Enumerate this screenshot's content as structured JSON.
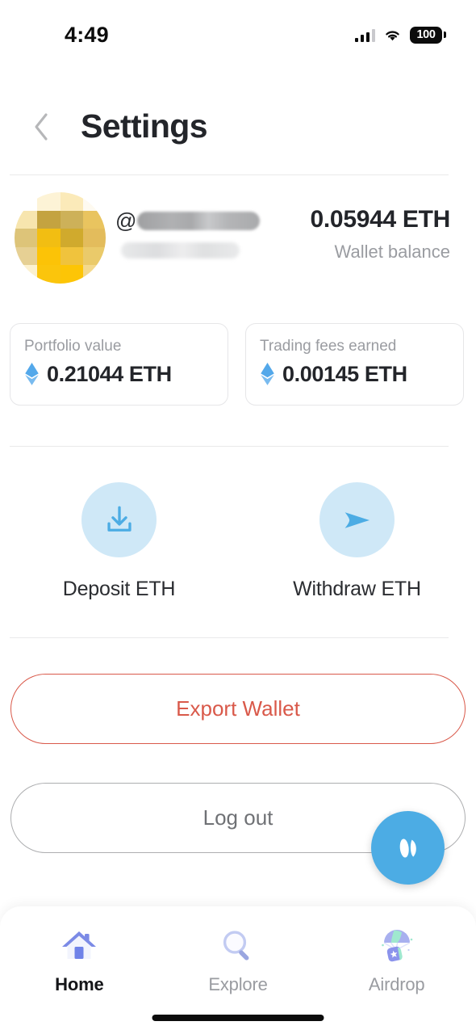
{
  "status_bar": {
    "time": "4:49",
    "battery_percent": "100",
    "icons": [
      "cellular-signal-icon",
      "wifi-icon",
      "battery-icon"
    ]
  },
  "header": {
    "back_icon": "chevron-left-icon",
    "title": "Settings"
  },
  "profile": {
    "avatar_icon": "pixelated-avatar",
    "avatar_colors": [
      "#ffffff",
      "#fdf2d2",
      "#fbe9b6",
      "#fdf6e2",
      "#f6e3ab",
      "#c3a13f",
      "#cdb059",
      "#e8c25d",
      "#ddc377",
      "#f2bd10",
      "#cfa92c",
      "#e2bb5a",
      "#e5cf92",
      "#fcc206",
      "#efc23c",
      "#e9c968",
      "#fbf0cd",
      "#fbc40b",
      "#fdc405",
      "#f3d municipality"
    ],
    "handle_prefix": "@",
    "handle_redacted": true,
    "subtitle_redacted": true,
    "balance_amount": "0.05944 ETH",
    "balance_label": "Wallet balance"
  },
  "stats": [
    {
      "label": "Portfolio value",
      "value": "0.21044 ETH",
      "icon": "ethereum-icon"
    },
    {
      "label": "Trading fees earned",
      "value": "0.00145 ETH",
      "icon": "ethereum-icon"
    }
  ],
  "actions": [
    {
      "label": "Deposit ETH",
      "icon": "download-tray-icon"
    },
    {
      "label": "Withdraw ETH",
      "icon": "send-plane-icon"
    }
  ],
  "buttons": {
    "export_wallet": "Export Wallet",
    "log_out": "Log out"
  },
  "fab": {
    "icon": "wings-logo-icon"
  },
  "bottom_nav": {
    "items": [
      {
        "label": "Home",
        "icon": "house-icon",
        "active": true
      },
      {
        "label": "Explore",
        "icon": "magnifier-icon",
        "active": false
      },
      {
        "label": "Airdrop",
        "icon": "parachute-gift-icon",
        "active": false
      }
    ]
  },
  "colors": {
    "accent_blue": "#4cace4",
    "eth_blue": "#53a8ea",
    "action_circle_bg": "#cfe8f7",
    "export_red": "#d9594a",
    "text_primary": "#23252a",
    "text_muted": "#9a9ca1",
    "divider": "#e9e9ea"
  }
}
